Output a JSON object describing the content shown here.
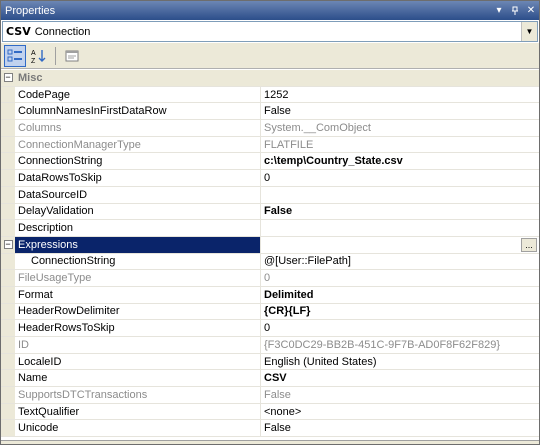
{
  "window": {
    "title": "Properties"
  },
  "object_selector": {
    "name": "CSV",
    "type": "Connection"
  },
  "grid": {
    "categories": {
      "misc": "Misc",
      "expressions": "Expressions"
    },
    "rows": [
      {
        "name": "CodePage",
        "value": "1252"
      },
      {
        "name": "ColumnNamesInFirstDataRow",
        "value": "False"
      },
      {
        "name": "Columns",
        "value": "System.__ComObject"
      },
      {
        "name": "ConnectionManagerType",
        "value": "FLATFILE"
      },
      {
        "name": "ConnectionString",
        "value": "c:\\temp\\Country_State.csv"
      },
      {
        "name": "DataRowsToSkip",
        "value": "0"
      },
      {
        "name": "DataSourceID",
        "value": ""
      },
      {
        "name": "DelayValidation",
        "value": "False"
      },
      {
        "name": "Description",
        "value": ""
      },
      {
        "name": "ConnectionString",
        "value": "@[User::FilePath]"
      },
      {
        "name": "FileUsageType",
        "value": "0"
      },
      {
        "name": "Format",
        "value": "Delimited"
      },
      {
        "name": "HeaderRowDelimiter",
        "value": "{CR}{LF}"
      },
      {
        "name": "HeaderRowsToSkip",
        "value": "0"
      },
      {
        "name": "ID",
        "value": "{F3C0DC29-BB2B-451C-9F7B-AD0F8F62F829}"
      },
      {
        "name": "LocaleID",
        "value": "English (United States)"
      },
      {
        "name": "Name",
        "value": "CSV"
      },
      {
        "name": "SupportsDTCTransactions",
        "value": "False"
      },
      {
        "name": "TextQualifier",
        "value": "<none>"
      },
      {
        "name": "Unicode",
        "value": "False"
      }
    ],
    "expressions_button": "..."
  }
}
